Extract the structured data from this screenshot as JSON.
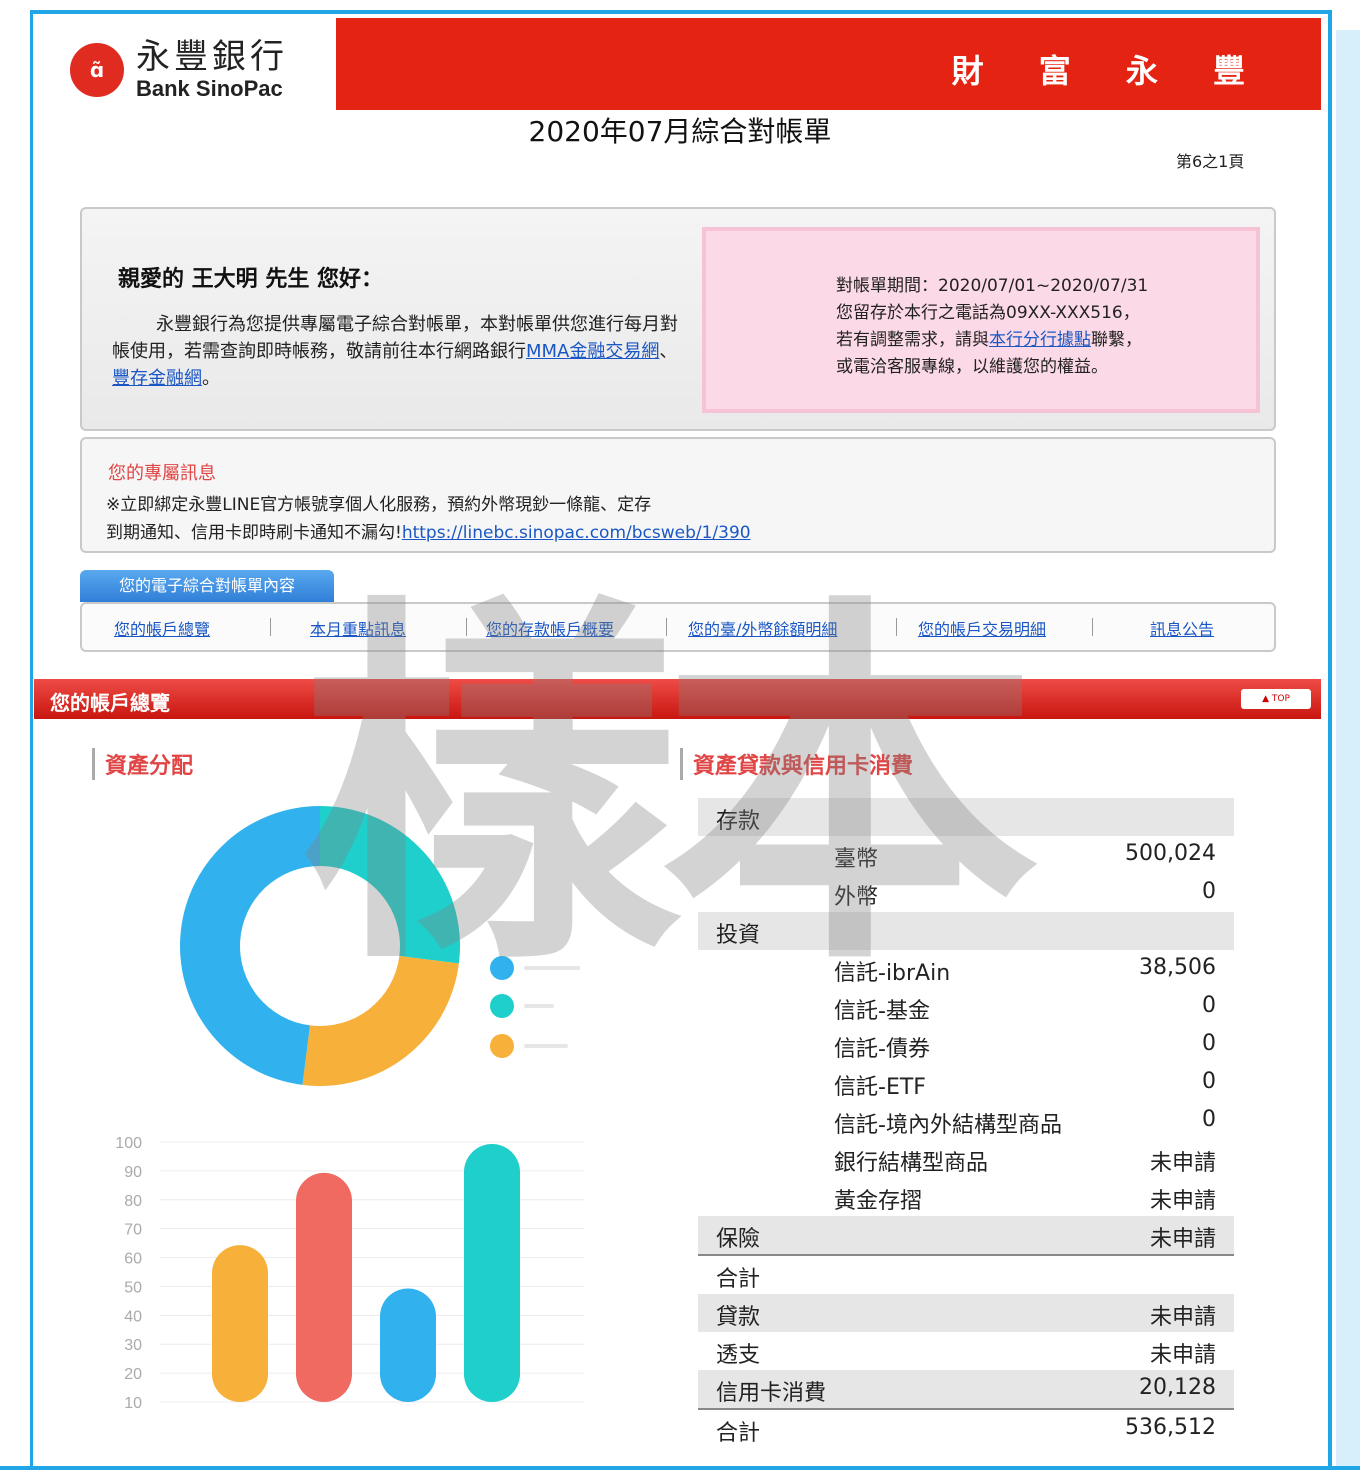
{
  "bank": {
    "name_cn": "永豐銀行",
    "name_en": "Bank SinoPac",
    "slogan": "財 富 永 豐"
  },
  "statement": {
    "title": "2020年07月綜合對帳單",
    "page": "第6之1頁"
  },
  "greeting": {
    "title": "親愛的 王大明 先生 您好：",
    "body_pre": "永豐銀行為您提供專屬電子綜合對帳單，本對帳單供您進行每月對帳使用，若需查詢即時帳務，敬請前往本行網路銀行",
    "link1": "MMA金融交易網",
    "sep": "、",
    "link2": "豐存金融網",
    "end": "。"
  },
  "notice": {
    "line1": "對帳單期間：2020/07/01~2020/07/31",
    "line2": "您留存於本行之電話為09XX-XXX516，",
    "line3_pre": "若有調整需求，請與",
    "line3_link": "本行分行據點",
    "line3_post": "聯繫，",
    "line4": "或電洽客服專線，以維護您的權益。"
  },
  "message": {
    "title": "您的專屬訊息",
    "line1": "※立即綁定永豐LINE官方帳號享個人化服務，預約外幣現鈔一條龍、定存",
    "line2_pre": "到期通知、信用卡即時刷卡通知不漏勾!",
    "line2_link": "https://linebc.sinopac.com/bcsweb/1/390"
  },
  "tabs": {
    "label": "您的電子綜合對帳單內容",
    "items": [
      "您的帳戶總覽",
      "本月重點訊息",
      "您的存款帳戶概要",
      "您的臺/外幣餘額明細",
      "您的帳戶交易明細",
      "訊息公告"
    ]
  },
  "section": {
    "title": "您的帳戶總覽",
    "top": "▲ TOP"
  },
  "asset_head": "資產分配",
  "table_head": "資產貸款與信用卡消費",
  "watermark": "樣本",
  "colors": {
    "blue": "#31b2ee",
    "teal": "#1ecfcb",
    "orange": "#f7b03a",
    "red": "#f06a61"
  },
  "chart_data": [
    {
      "type": "pie",
      "donut": true,
      "values": [
        48,
        27,
        25
      ],
      "colors": [
        "#31b2ee",
        "#1ecfcb",
        "#f7b03a"
      ],
      "legend_placement": "right"
    },
    {
      "type": "bar",
      "ylim": [
        10,
        100
      ],
      "yticks": [
        100,
        90,
        80,
        70,
        60,
        50,
        40,
        30,
        20,
        10
      ],
      "values": [
        65,
        90,
        50,
        100
      ],
      "colors": [
        "#f7b03a",
        "#f06a61",
        "#31b2ee",
        "#1ecfcb"
      ],
      "grid": true
    }
  ],
  "rows": [
    {
      "label": "存款",
      "value": "",
      "shade": true,
      "indent": false
    },
    {
      "label": "臺幣",
      "value": "500,024",
      "shade": false,
      "indent": true
    },
    {
      "label": "外幣",
      "value": "0",
      "shade": false,
      "indent": true
    },
    {
      "label": "投資",
      "value": "",
      "shade": true,
      "indent": false
    },
    {
      "label": "信託-ibrAin",
      "value": "38,506",
      "shade": false,
      "indent": true
    },
    {
      "label": "信託-基金",
      "value": "0",
      "shade": false,
      "indent": true
    },
    {
      "label": "信託-債券",
      "value": "0",
      "shade": false,
      "indent": true
    },
    {
      "label": "信託-ETF",
      "value": "0",
      "shade": false,
      "indent": true
    },
    {
      "label": "信託-境內外結構型商品",
      "value": "0",
      "shade": false,
      "indent": true
    },
    {
      "label": "銀行結構型商品",
      "value": "未申請",
      "shade": false,
      "indent": true
    },
    {
      "label": "黃金存摺",
      "value": "未申請",
      "shade": false,
      "indent": true
    },
    {
      "label": "保險",
      "value": "未申請",
      "shade": true,
      "indent": false,
      "line": "b"
    },
    {
      "label": "合計",
      "value": "",
      "shade": false,
      "indent": false
    },
    {
      "label": "貸款",
      "value": "未申請",
      "shade": true,
      "indent": false
    },
    {
      "label": "透支",
      "value": "未申請",
      "shade": false,
      "indent": false
    },
    {
      "label": "信用卡消費",
      "value": "20,128",
      "shade": true,
      "indent": false,
      "line": "b"
    },
    {
      "label": "合計",
      "value": "536,512",
      "shade": false,
      "indent": false
    }
  ]
}
